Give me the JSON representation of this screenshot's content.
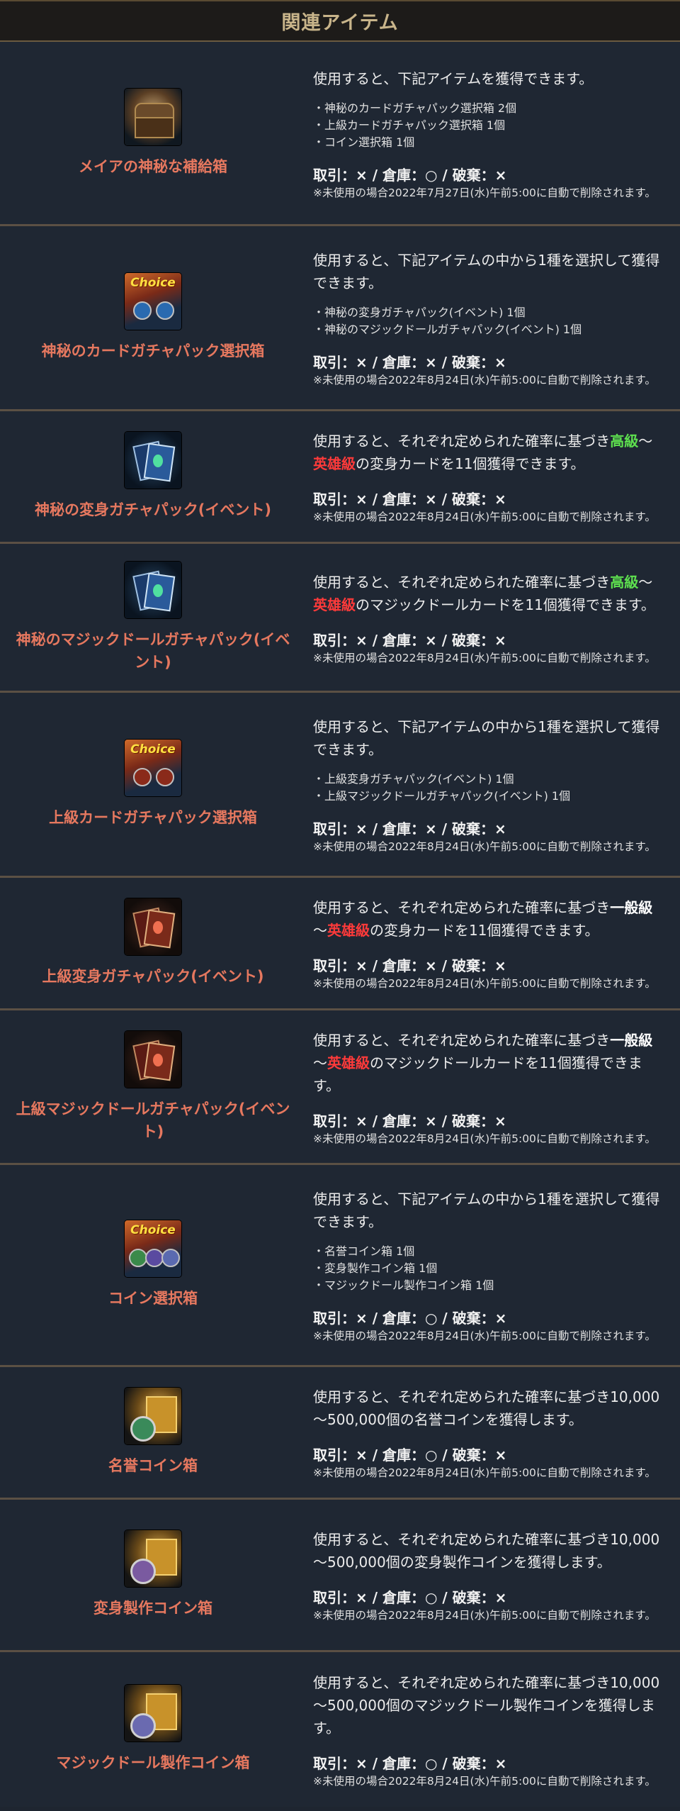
{
  "header": {
    "title": "関連アイテム"
  },
  "items": [
    {
      "name": "メイアの神秘な補給箱",
      "desc": "使用すると、下記アイテムを獲得できます。",
      "bullets": [
        "・神秘のカードガチャパック選択箱 2個",
        "・上級カードガチャパック選択箱 1個",
        "・コイン選択箱 1個"
      ],
      "trade": "取引：× / 倉庫：○ / 破棄：×",
      "note": "※未使用の場合2022年7月27日(水)午前5:00に自動で削除されます。"
    },
    {
      "name": "神秘のカードガチャパック選択箱",
      "desc": "使用すると、下記アイテムの中から1種を選択して獲得できます。",
      "bullets": [
        "・神秘の変身ガチャパック(イベント) 1個",
        "・神秘のマジックドールガチャパック(イベント) 1個"
      ],
      "trade": "取引：× / 倉庫：× / 破棄：×",
      "note": "※未使用の場合2022年8月24日(水)午前5:00に自動で削除されます。"
    },
    {
      "name": "神秘の変身ガチャパック(イベント)",
      "desc_parts": [
        "使用すると、それぞれ定められた確率に基づき",
        "高級",
        "～",
        "英雄級",
        "の変身カードを11個獲得できます。"
      ],
      "trade": "取引：× / 倉庫：× / 破棄：×",
      "note": "※未使用の場合2022年8月24日(水)午前5:00に自動で削除されます。"
    },
    {
      "name": "神秘のマジックドールガチャパック(イベント)",
      "desc_parts": [
        "使用すると、それぞれ定められた確率に基づき",
        "高級",
        "～",
        "英雄級",
        "のマジックドールカードを11個獲得できます。"
      ],
      "trade": "取引：× / 倉庫：× / 破棄：×",
      "note": "※未使用の場合2022年8月24日(水)午前5:00に自動で削除されます。"
    },
    {
      "name": "上級カードガチャパック選択箱",
      "desc": "使用すると、下記アイテムの中から1種を選択して獲得できます。",
      "bullets": [
        "・上級変身ガチャパック(イベント) 1個",
        "・上級マジックドールガチャパック(イベント) 1個"
      ],
      "trade": "取引：× / 倉庫：× / 破棄：×",
      "note": "※未使用の場合2022年8月24日(水)午前5:00に自動で削除されます。"
    },
    {
      "name": "上級変身ガチャパック(イベント)",
      "desc_parts": [
        "使用すると、それぞれ定められた確率に基づき",
        "一般級",
        "～",
        "英雄級",
        "の変身カードを11個獲得できます。"
      ],
      "trade": "取引：× / 倉庫：× / 破棄：×",
      "note": "※未使用の場合2022年8月24日(水)午前5:00に自動で削除されます。"
    },
    {
      "name": "上級マジックドールガチャパック(イベント)",
      "desc_parts": [
        "使用すると、それぞれ定められた確率に基づき",
        "一般級",
        "～",
        "英雄級",
        "のマジックドールカードを11個獲得できます。"
      ],
      "trade": "取引：× / 倉庫：× / 破棄：×",
      "note": "※未使用の場合2022年8月24日(水)午前5:00に自動で削除されます。"
    },
    {
      "name": "コイン選択箱",
      "desc": "使用すると、下記アイテムの中から1種を選択して獲得できます。",
      "bullets": [
        "・名誉コイン箱 1個",
        "・変身製作コイン箱 1個",
        "・マジックドール製作コイン箱 1個"
      ],
      "trade": "取引：× / 倉庫：○ / 破棄：×",
      "note": "※未使用の場合2022年8月24日(水)午前5:00に自動で削除されます。"
    },
    {
      "name": "名誉コイン箱",
      "desc": "使用すると、それぞれ定められた確率に基づき10,000～500,000個の名誉コインを獲得します。",
      "trade": "取引：× / 倉庫：○ / 破棄：×",
      "note": "※未使用の場合2022年8月24日(水)午前5:00に自動で削除されます。"
    },
    {
      "name": "変身製作コイン箱",
      "desc": "使用すると、それぞれ定められた確率に基づき10,000～500,000個の変身製作コインを獲得します。",
      "trade": "取引：× / 倉庫：○ / 破棄：×",
      "note": "※未使用の場合2022年8月24日(水)午前5:00に自動で削除されます。"
    },
    {
      "name": "マジックドール製作コイン箱",
      "desc": "使用すると、それぞれ定められた確率に基づき10,000～500,000個のマジックドール製作コインを獲得します。",
      "trade": "取引：× / 倉庫：○ / 破棄：×",
      "note": "※未使用の場合2022年8月24日(水)午前5:00に自動で削除されます。"
    }
  ],
  "icons": {
    "choice_tag": "Choice",
    "names": [
      "treasure-chest-icon",
      "choice-box-icon",
      "card-pack-icon",
      "card-pack-icon",
      "choice-box-icon",
      "red-card-pack-icon",
      "red-card-pack-icon",
      "choice-box-icon",
      "gold-coin-box-icon",
      "gold-coin-box-icon",
      "gold-coin-box-icon"
    ]
  },
  "colors": {
    "item_name": "#e6785f",
    "grade_green": "#5ee04f",
    "grade_red": "#ff3a3a",
    "header_title": "#c8b48a",
    "background": "#1e2530"
  }
}
